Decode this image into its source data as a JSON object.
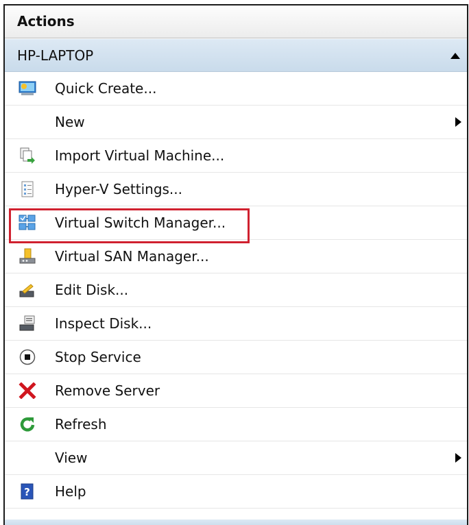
{
  "panel": {
    "title": "Actions"
  },
  "section": {
    "title": "HP-LAPTOP"
  },
  "items": [
    {
      "label": "Quick Create...",
      "icon": "quick-create-icon"
    },
    {
      "label": "New",
      "icon": "",
      "submenu": true
    },
    {
      "label": "Import Virtual Machine...",
      "icon": "import-icon"
    },
    {
      "label": "Hyper-V Settings...",
      "icon": "settings-icon"
    },
    {
      "label": "Virtual Switch Manager...",
      "icon": "switch-manager-icon",
      "highlighted": true
    },
    {
      "label": "Virtual SAN Manager...",
      "icon": "san-manager-icon"
    },
    {
      "label": "Edit Disk...",
      "icon": "edit-disk-icon"
    },
    {
      "label": "Inspect Disk...",
      "icon": "inspect-disk-icon"
    },
    {
      "label": "Stop Service",
      "icon": "stop-icon"
    },
    {
      "label": "Remove Server",
      "icon": "remove-icon"
    },
    {
      "label": "Refresh",
      "icon": "refresh-icon"
    },
    {
      "label": "View",
      "icon": "",
      "submenu": true
    },
    {
      "label": "Help",
      "icon": "help-icon"
    }
  ],
  "colors": {
    "highlight_border": "#d0212f",
    "section_header_bg": "#c9dbeb",
    "remove_red": "#d0161f",
    "refresh_green": "#2e9a3a",
    "help_blue": "#2a55b8"
  }
}
